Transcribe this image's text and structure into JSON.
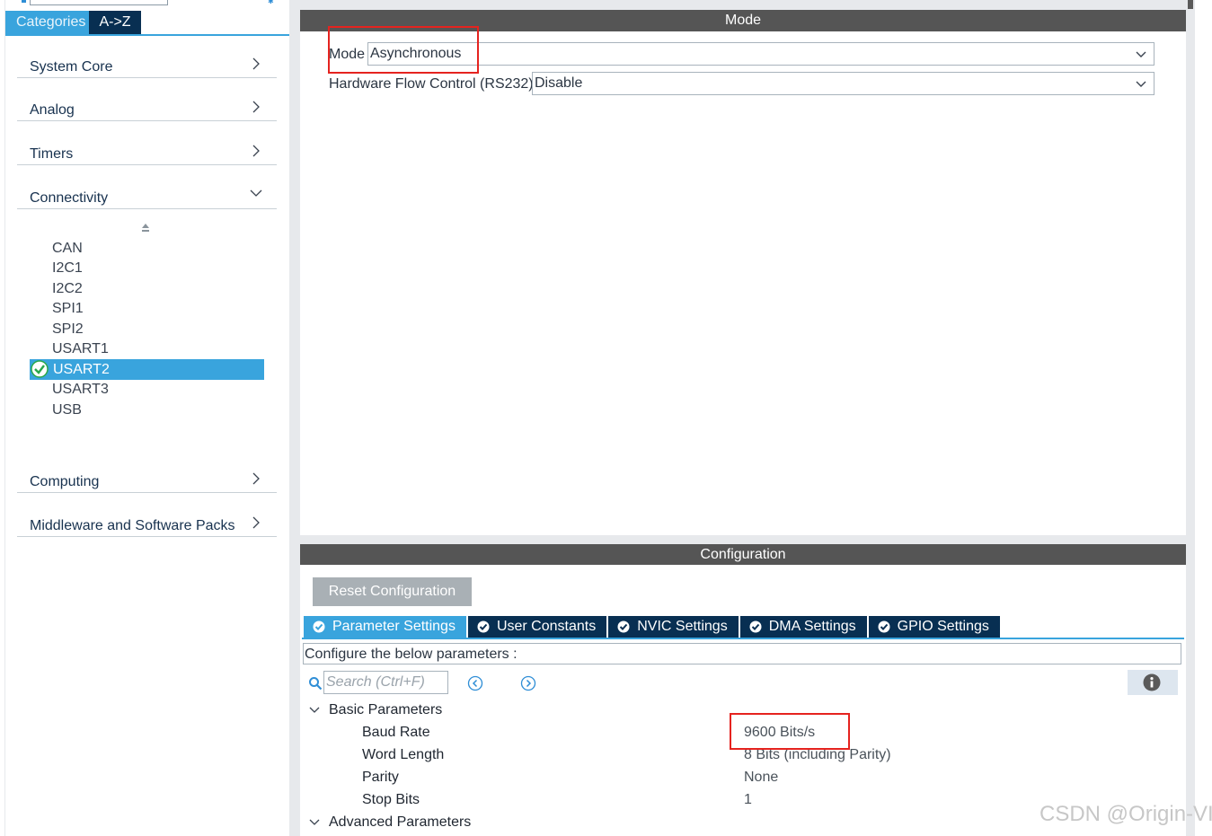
{
  "sidebar": {
    "tabs": {
      "categories": "Categories",
      "az": "A->Z"
    },
    "categories": [
      {
        "label": "System Core",
        "expanded": false
      },
      {
        "label": "Analog",
        "expanded": false
      },
      {
        "label": "Timers",
        "expanded": false
      },
      {
        "label": "Connectivity",
        "expanded": true
      },
      {
        "label": "Computing",
        "expanded": false
      },
      {
        "label": "Middleware and Software Packs",
        "expanded": false
      }
    ],
    "connectivity_items": [
      "CAN",
      "I2C1",
      "I2C2",
      "SPI1",
      "SPI2",
      "USART1",
      "USART2",
      "USART3",
      "USB"
    ],
    "selected_item": "USART2"
  },
  "mode": {
    "header": "Mode",
    "fields": [
      {
        "label": "Mode",
        "value": "Asynchronous"
      },
      {
        "label": "Hardware Flow Control (RS232)",
        "value": "Disable"
      }
    ]
  },
  "config": {
    "header": "Configuration",
    "reset_button": "Reset Configuration",
    "tabs": [
      "Parameter Settings",
      "User Constants",
      "NVIC Settings",
      "DMA Settings",
      "GPIO Settings"
    ],
    "active_tab": "Parameter Settings",
    "instruction": "Configure the below parameters :",
    "search_placeholder": "Search (Ctrl+F)",
    "groups": {
      "basic": "Basic Parameters",
      "advanced": "Advanced Parameters"
    },
    "basic_params": [
      {
        "name": "Baud Rate",
        "value": "9600 Bits/s"
      },
      {
        "name": "Word Length",
        "value": "8 Bits (including Parity)"
      },
      {
        "name": "Parity",
        "value": "None"
      },
      {
        "name": "Stop Bits",
        "value": "1"
      }
    ]
  },
  "watermark": "CSDN @Origin-VI",
  "colors": {
    "accent": "#39a4dd",
    "dark_tab": "#082f52",
    "panel_header": "#555555",
    "highlight_box": "#e5231f",
    "check_green": "#2aa84a"
  }
}
